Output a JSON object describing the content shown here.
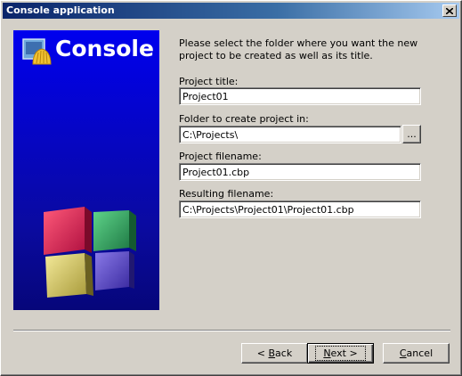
{
  "window": {
    "title": "Console application"
  },
  "banner": {
    "title": "Console"
  },
  "instructions": "Please select the folder where you want the new project to be created as well as its title.",
  "fields": {
    "project_title": {
      "label": "Project title:",
      "value": "Project01"
    },
    "folder": {
      "label": "Folder to create project in:",
      "value": "C:\\Projects\\",
      "browse_label": "..."
    },
    "project_filename": {
      "label": "Project filename:",
      "value": "Project01.cbp"
    },
    "resulting_filename": {
      "label": "Resulting filename:",
      "value": "C:\\Projects\\Project01\\Project01.cbp"
    }
  },
  "buttons": {
    "back": {
      "prefix": "< ",
      "mnemonic": "B",
      "rest": "ack"
    },
    "next": {
      "mnemonic": "N",
      "rest": "ext >"
    },
    "cancel": {
      "mnemonic": "C",
      "rest": "ancel"
    }
  },
  "icons": {
    "close": "close-icon",
    "banner_logo": "console-app-icon",
    "banner_art": "cubes-logo"
  },
  "colors": {
    "title_bar_start": "#0a246a",
    "title_bar_end": "#a6caf0",
    "banner_blue": "#0000ee",
    "face": "#d4d0c8"
  }
}
